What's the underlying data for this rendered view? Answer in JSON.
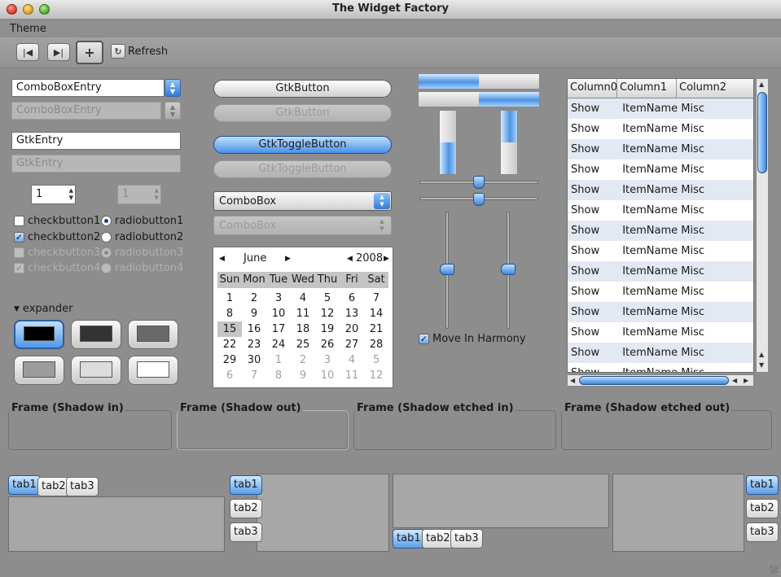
{
  "window": {
    "title": "The Widget Factory"
  },
  "menu": {
    "theme": "Theme"
  },
  "toolbar": {
    "refresh": "Refresh"
  },
  "left": {
    "combo_entry": "ComboBoxEntry",
    "combo_entry_disabled": "ComboBoxEntry",
    "entry": "GtkEntry",
    "entry_disabled": "GtkEntry",
    "spin1": "1",
    "spin2": "1",
    "checks": [
      "checkbutton1",
      "checkbutton2",
      "checkbutton3",
      "checkbutton4"
    ],
    "radios": [
      "radiobutton1",
      "radiobutton2",
      "radiobutton3",
      "radiobutton4"
    ],
    "expander": "expander"
  },
  "middle": {
    "button": "GtkButton",
    "button_disabled": "GtkButton",
    "toggle": "GtkToggleButton",
    "toggle_disabled": "GtkToggleButton",
    "combobox": "ComboBox",
    "combobox_disabled": "ComboBox"
  },
  "calendar": {
    "month": "June",
    "year": "2008",
    "days": [
      "Sun",
      "Mon",
      "Tue",
      "Wed",
      "Thu",
      "Fri",
      "Sat"
    ],
    "weeks": [
      [
        "1",
        "2",
        "3",
        "4",
        "5",
        "6",
        "7"
      ],
      [
        "8",
        "9",
        "10",
        "11",
        "12",
        "13",
        "14"
      ],
      [
        "15",
        "16",
        "17",
        "18",
        "19",
        "20",
        "21"
      ],
      [
        "22",
        "23",
        "24",
        "25",
        "26",
        "27",
        "28"
      ],
      [
        "29",
        "30",
        "1",
        "2",
        "3",
        "4",
        "5"
      ],
      [
        "6",
        "7",
        "8",
        "9",
        "10",
        "11",
        "12"
      ]
    ],
    "selected": "15"
  },
  "progress": {
    "h1": 0.5,
    "h2": 0.5,
    "v1": 0.5,
    "v2": 0.5
  },
  "harmony": "Move In Harmony",
  "tree": {
    "columns": [
      "Column0",
      "Column1",
      "Column2"
    ],
    "rows": [
      [
        "Show",
        "ItemName",
        "Misc"
      ],
      [
        "Show",
        "ItemName",
        "Misc"
      ],
      [
        "Show",
        "ItemName",
        "Misc"
      ],
      [
        "Show",
        "ItemName",
        "Misc"
      ],
      [
        "Show",
        "ItemName",
        "Misc"
      ],
      [
        "Show",
        "ItemName",
        "Misc"
      ],
      [
        "Show",
        "ItemName",
        "Misc"
      ],
      [
        "Show",
        "ItemName",
        "Misc"
      ],
      [
        "Show",
        "ItemName",
        "Misc"
      ],
      [
        "Show",
        "ItemName",
        "Misc"
      ],
      [
        "Show",
        "ItemName",
        "Misc"
      ],
      [
        "Show",
        "ItemName",
        "Misc"
      ],
      [
        "Show",
        "ItemName",
        "Misc"
      ],
      [
        "Show",
        "ItemName",
        "Misc"
      ]
    ]
  },
  "frames": [
    "Frame (Shadow in)",
    "Frame (Shadow out)",
    "Frame (Shadow etched in)",
    "Frame (Shadow etched out)"
  ],
  "tabs": [
    "tab1",
    "tab2",
    "tab3"
  ],
  "colors": {
    "accent": "#4a90e3",
    "window_bg": "#8d8d8d"
  }
}
